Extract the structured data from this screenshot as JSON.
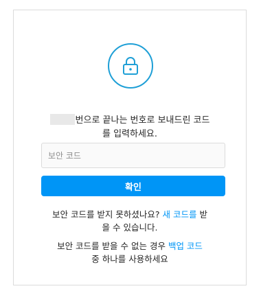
{
  "icon": {
    "name": "lock-icon",
    "color": "#1e9fd6"
  },
  "message": {
    "line1_suffix": "번으로 끝나는 번호로 보내드린 코드",
    "line2": "를 입력하세요."
  },
  "code_input": {
    "placeholder": "보안 코드",
    "value": ""
  },
  "confirm_button": {
    "label": "확인",
    "color": "#0095f6"
  },
  "resend": {
    "prefix": "보안 코드를 받지 못하셨나요?",
    "link": "새 코드를",
    "suffix_line1": "받",
    "line2": "을 수 있습니다."
  },
  "backup": {
    "prefix": "보안 코드를 받을 수 없는 경우",
    "link": "백업 코드",
    "line2": "중 하나를 사용하세요"
  }
}
